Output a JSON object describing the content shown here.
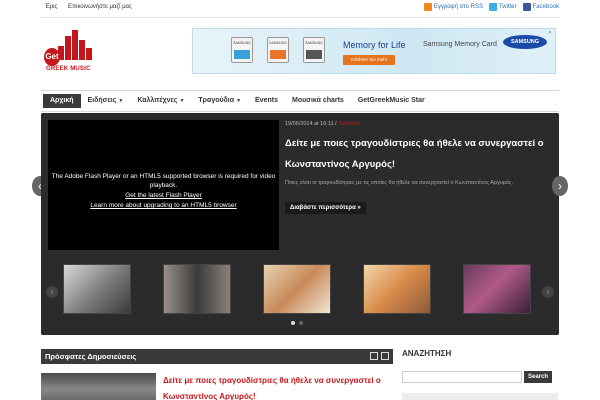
{
  "topbar": {
    "links": [
      "Έρις",
      "Επικοινωνήστε μαζί μας"
    ],
    "social": [
      {
        "label": "Εγγραφή στο RSS",
        "icon": "rss-icon"
      },
      {
        "label": "Twitter",
        "icon": "twitter-icon"
      },
      {
        "label": "Facebook",
        "icon": "facebook-icon"
      }
    ]
  },
  "logo": {
    "mark": "Get",
    "word": "GREEK MUSIC"
  },
  "ad": {
    "cards": [
      "SAMSUNG",
      "SAMSUNG",
      "SAMSUNG"
    ],
    "title": "Memory for Life",
    "subtitle": "Samsung Memory Card",
    "button": "Erfahren Sie mehr",
    "brand": "SAMSUNG"
  },
  "nav": {
    "items": [
      {
        "label": "Αρχική",
        "caret": ""
      },
      {
        "label": "Ειδήσεις",
        "caret": "▼"
      },
      {
        "label": "Καλλιτέχνες",
        "caret": "▼"
      },
      {
        "label": "Τραγούδια",
        "caret": "▼"
      },
      {
        "label": "Events",
        "caret": ""
      },
      {
        "label": "Μουσικά charts",
        "caret": ""
      },
      {
        "label": "GetGreekMusic Star",
        "caret": ""
      }
    ]
  },
  "slider": {
    "video": {
      "message": "The Adobe Flash Player or an HTML5 supported browser is required for video playback.",
      "link1": "Get the latest Flash Player",
      "link2": "Learn more about upgrading to an HTML5 browser"
    },
    "date": "19/06/2014 at 16:11 /",
    "category": "Ειδήσεις",
    "title": "Δείτε με ποιες τραγουδίστριες θα ήθελε να συνεργαστεί ο Κωνσταντίνος Αργυρός!",
    "description": "Ποιες είναι οι τραγουδίστριες με τις οποίες θα ήθελε να συνεργαστεί ο Κωνσταντίνος Αργυρός.",
    "read_more": "Διαβάστε περισσότερα »",
    "prev": "‹",
    "next": "›"
  },
  "recent": {
    "heading": "Πρόσφατες Δημοσιεύσεις",
    "post_title": "Δείτε με ποιες τραγουδίστριες θα ήθελε να συνεργαστεί ο Κωνσταντίνος Αργυρός!"
  },
  "search": {
    "heading": "ΑΝΑΖΗΤΗΣΗ",
    "placeholder": "",
    "button": "Search"
  }
}
